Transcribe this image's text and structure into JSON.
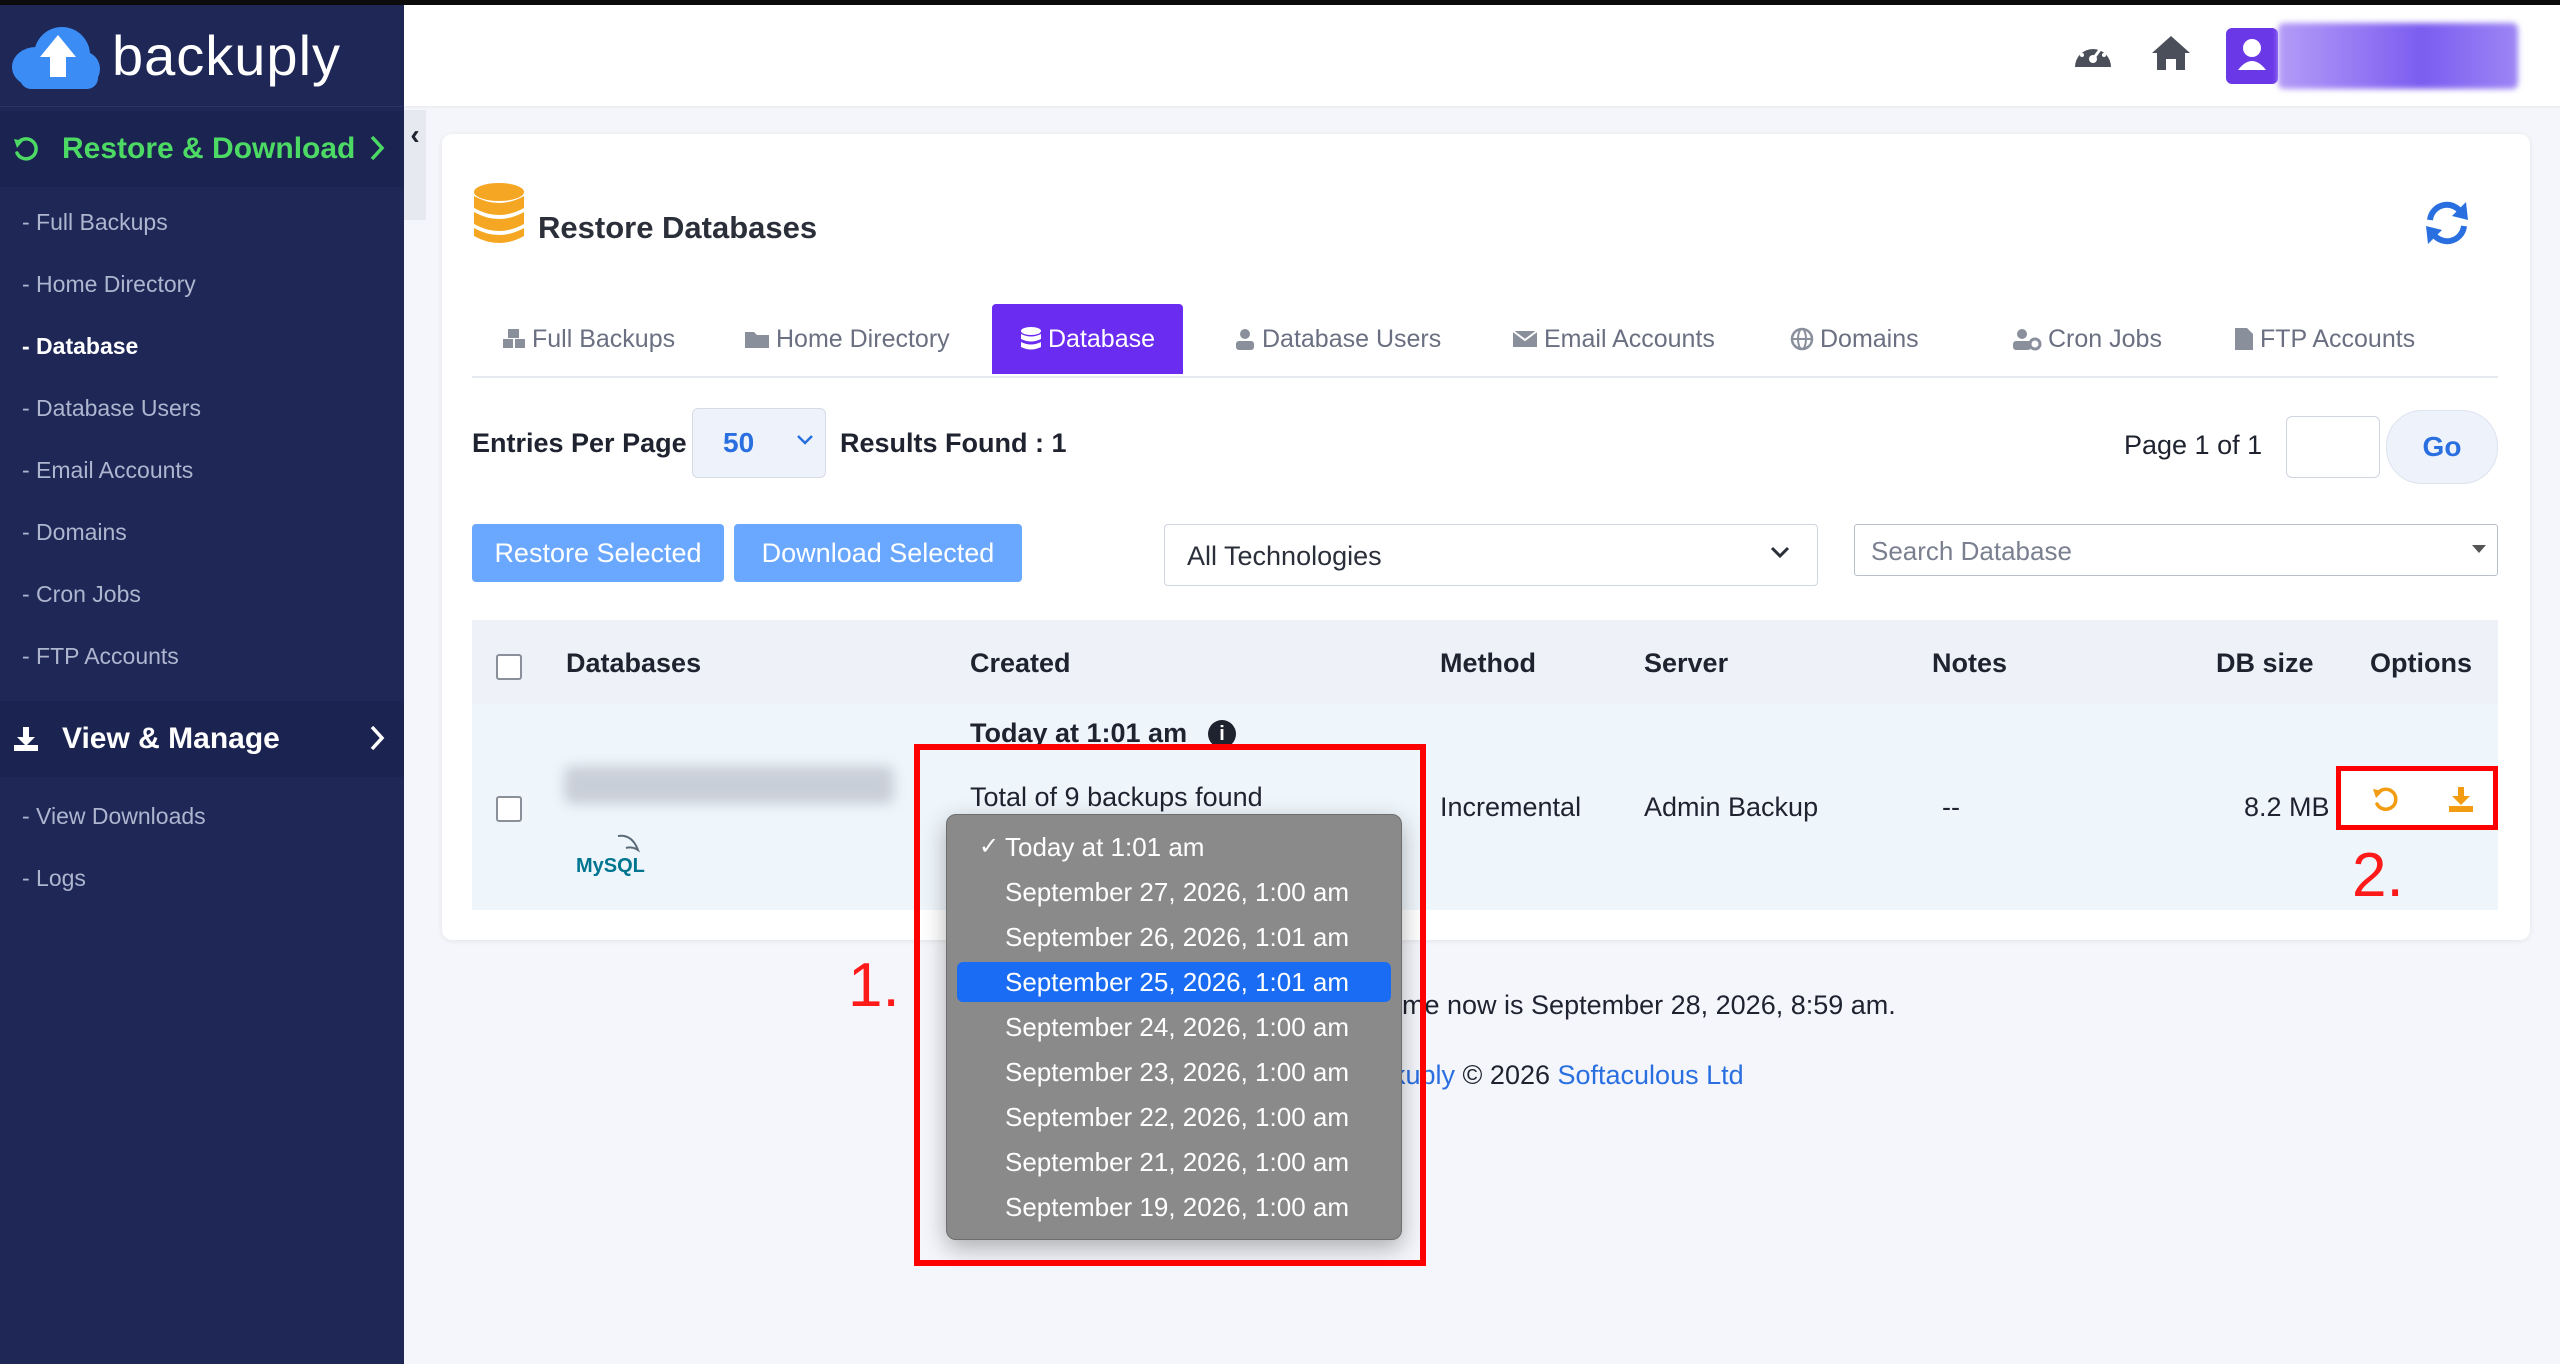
{
  "brand": {
    "name": "backuply"
  },
  "sidebar": {
    "restore_section": {
      "label": "Restore & Download"
    },
    "restore_items": [
      {
        "label": "- Full Backups",
        "active": false
      },
      {
        "label": "- Home Directory",
        "active": false
      },
      {
        "label": "- Database",
        "active": true
      },
      {
        "label": "- Database Users",
        "active": false
      },
      {
        "label": "- Email Accounts",
        "active": false
      },
      {
        "label": "- Domains",
        "active": false
      },
      {
        "label": "- Cron Jobs",
        "active": false
      },
      {
        "label": "- FTP Accounts",
        "active": false
      }
    ],
    "view_section": {
      "label": "View & Manage"
    },
    "view_items": [
      {
        "label": "- View Downloads"
      },
      {
        "label": "- Logs"
      }
    ],
    "collapse_label": "‹"
  },
  "header": {
    "icons": [
      "dashboard-gauge-icon",
      "home-icon",
      "user-avatar-icon"
    ]
  },
  "page": {
    "title": "Restore Databases",
    "tabs": [
      {
        "label": "Full Backups",
        "icon": "cubes-icon"
      },
      {
        "label": "Home Directory",
        "icon": "folder-icon"
      },
      {
        "label": "Database",
        "icon": "database-icon",
        "active": true
      },
      {
        "label": "Database Users",
        "icon": "user-icon"
      },
      {
        "label": "Email Accounts",
        "icon": "envelope-icon"
      },
      {
        "label": "Domains",
        "icon": "globe-icon"
      },
      {
        "label": "Cron Jobs",
        "icon": "users-cog-icon"
      },
      {
        "label": "FTP Accounts",
        "icon": "file-icon"
      }
    ],
    "entries_label": "Entries Per Page",
    "entries_value": "50",
    "results_found": "Results Found : 1",
    "page_of": "Page 1 of 1",
    "go_label": "Go",
    "restore_selected": "Restore Selected",
    "download_selected": "Download Selected",
    "technology_value": "All Technologies",
    "search_placeholder": "Search Database"
  },
  "table": {
    "headers": [
      "Databases",
      "Created",
      "Method",
      "Server",
      "Notes",
      "DB size",
      "Options"
    ],
    "row": {
      "db_type_logo": "MySQL",
      "created_title": "Today at 1:01 am",
      "created_info": "i",
      "total_backups": "Total of 9 backups found",
      "method": "Incremental",
      "server": "Admin Backup",
      "notes": "--",
      "db_size": "8.2 MB"
    }
  },
  "dropdown": {
    "options": [
      {
        "label": "Today at 1:01 am",
        "checked": true
      },
      {
        "label": "September 27, 2026, 1:00 am"
      },
      {
        "label": "September 26, 2026, 1:01 am"
      },
      {
        "label": "September 25, 2026, 1:01 am",
        "highlighted": true
      },
      {
        "label": "September 24, 2026, 1:00 am"
      },
      {
        "label": "September 23, 2026, 1:00 am"
      },
      {
        "label": "September 22, 2026, 1:00 am"
      },
      {
        "label": "September 21, 2026, 1:00 am"
      },
      {
        "label": "September 19, 2026, 1:00 am"
      }
    ],
    "check_glyph": "✓"
  },
  "annotations": {
    "marker_1": "1.",
    "marker_2": "2."
  },
  "footer": {
    "time_text": "me now is September 28, 2026, 8:59 am.",
    "brand_link": "kuply",
    "copyright": " © 2026 ",
    "company_link": "Softaculous Ltd"
  },
  "colors": {
    "sidebar_bg": "#1e2756",
    "accent_purple": "#6a2cf0",
    "green": "#4cd964",
    "button_blue": "#6aa8ff",
    "option_orange": "#f39c12",
    "annotation_red": "#ff0000"
  }
}
